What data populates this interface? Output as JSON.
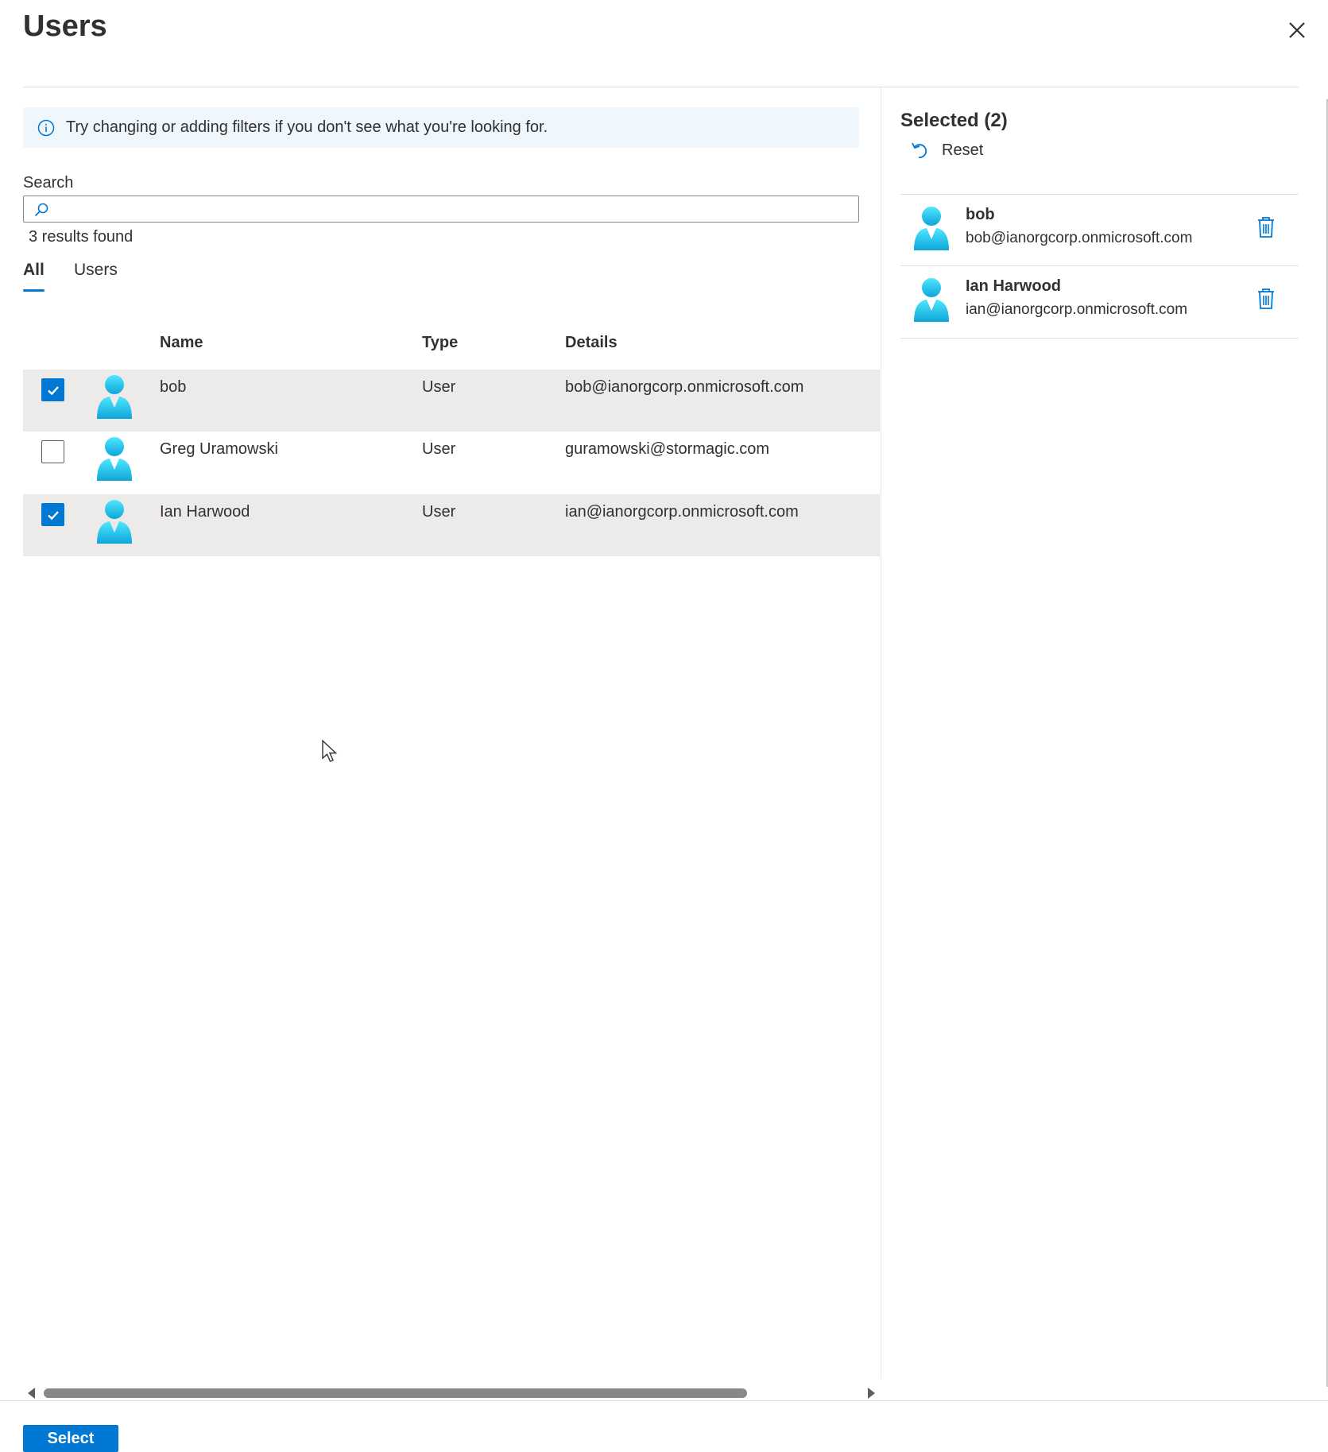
{
  "panel": {
    "title": "Users"
  },
  "info": {
    "message": "Try changing or adding filters if you don't see what you're looking for."
  },
  "search": {
    "label": "Search",
    "value": "",
    "placeholder": ""
  },
  "results_text": "3 results found",
  "tabs": [
    {
      "label": "All",
      "active": true
    },
    {
      "label": "Users",
      "active": false
    }
  ],
  "table": {
    "headers": {
      "name": "Name",
      "type": "Type",
      "details": "Details"
    },
    "rows": [
      {
        "name": "bob",
        "type": "User",
        "details": "bob@ianorgcorp.onmicrosoft.com",
        "checked": true
      },
      {
        "name": "Greg Uramowski",
        "type": "User",
        "details": "guramowski@stormagic.com",
        "checked": false
      },
      {
        "name": "Ian Harwood",
        "type": "User",
        "details": "ian@ianorgcorp.onmicrosoft.com",
        "checked": true
      }
    ]
  },
  "selected_panel": {
    "title": "Selected (2)",
    "reset_label": "Reset",
    "items": [
      {
        "name": "bob",
        "email": "bob@ianorgcorp.onmicrosoft.com"
      },
      {
        "name": "Ian Harwood",
        "email": "ian@ianorgcorp.onmicrosoft.com"
      }
    ]
  },
  "footer": {
    "select_label": "Select"
  },
  "icons": {
    "close": "close-icon",
    "info": "info-icon",
    "search": "search-icon",
    "user": "user-avatar-icon",
    "reset": "undo-icon",
    "delete": "trash-icon",
    "check": "checkmark-icon"
  },
  "colors": {
    "accent": "#0078d4",
    "info_bg": "#eff6fc",
    "selected_row": "#edebe9",
    "avatar_light": "#50e6ff",
    "avatar_dark": "#0ea5d8"
  }
}
